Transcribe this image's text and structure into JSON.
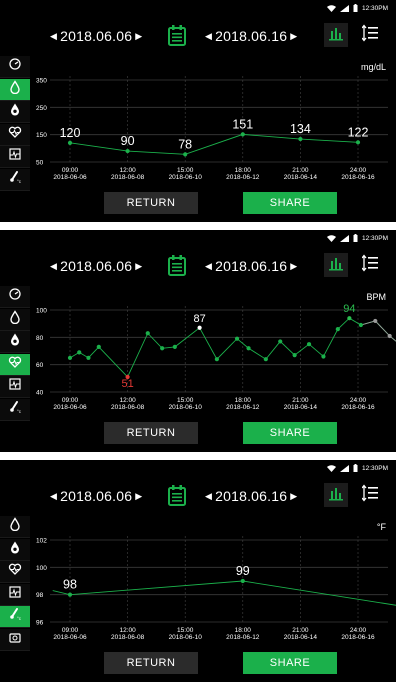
{
  "colors": {
    "accent": "#1bb04b",
    "background": "#000000",
    "grid": "#3a3a3a",
    "low": "#e53935",
    "high_label": "#2bbd4f"
  },
  "status": {
    "time": "12:30PM",
    "icons": [
      "wifi-icon",
      "signal-icon",
      "battery-icon"
    ]
  },
  "panels": [
    {
      "start_date": "2018.06.06",
      "end_date": "2018.06.16",
      "unit": "mg/dL",
      "active_metric": "glucose",
      "sidebar": [
        "blood-pressure-icon",
        "glucose-drop-icon",
        "oxygen-drop-icon",
        "heart-rate-icon",
        "ecg-icon",
        "temperature-icon"
      ],
      "return_label": "RETURN",
      "share_label": "SHARE",
      "chart_data": {
        "type": "line",
        "ylim": [
          50,
          350
        ],
        "yticks": [
          "350",
          "250",
          "150",
          "50"
        ],
        "ytick_values": [
          350,
          250,
          150,
          50
        ],
        "xtick_times": [
          "09:00",
          "12:00",
          "15:00",
          "18:00",
          "21:00",
          "24:00"
        ],
        "xtick_dates": [
          "2018-06-06",
          "2018-06-08",
          "2018-06-10",
          "2018-06-12",
          "2018-06-14",
          "2018-06-16"
        ],
        "points": [
          {
            "x": 0,
            "y": 120,
            "label": "120"
          },
          {
            "x": 1,
            "y": 90,
            "label": "90"
          },
          {
            "x": 2,
            "y": 78,
            "label": "78"
          },
          {
            "x": 3,
            "y": 151,
            "label": "151"
          },
          {
            "x": 4,
            "y": 134,
            "label": "134"
          },
          {
            "x": 5,
            "y": 122,
            "label": "122"
          }
        ]
      }
    },
    {
      "start_date": "2018.06.06",
      "end_date": "2018.06.16",
      "unit": "BPM",
      "active_metric": "heart-rate",
      "sidebar": [
        "blood-pressure-icon",
        "glucose-drop-icon",
        "oxygen-drop-icon",
        "heart-rate-icon",
        "ecg-icon",
        "temperature-icon"
      ],
      "return_label": "RETURN",
      "share_label": "SHARE",
      "chart_data": {
        "type": "line",
        "ylim": [
          40,
          100
        ],
        "yticks": [
          "100",
          "80",
          "60",
          "40"
        ],
        "ytick_values": [
          100,
          80,
          60,
          40
        ],
        "xtick_times": [
          "09:00",
          "12:00",
          "15:00",
          "18:00",
          "21:00",
          "24:00"
        ],
        "xtick_dates": [
          "2018-06-06",
          "2018-06-08",
          "2018-06-10",
          "2018-06-12",
          "2018-06-14",
          "2018-06-16"
        ],
        "points": [
          {
            "x": 0.0,
            "y": 65
          },
          {
            "x": 0.16,
            "y": 69
          },
          {
            "x": 0.32,
            "y": 65
          },
          {
            "x": 0.5,
            "y": 73
          },
          {
            "x": 1.0,
            "y": 51,
            "label": "51",
            "color": "#e53935"
          },
          {
            "x": 1.35,
            "y": 83
          },
          {
            "x": 1.6,
            "y": 72
          },
          {
            "x": 1.82,
            "y": 73
          },
          {
            "x": 2.25,
            "y": 87,
            "label": "87",
            "color": "#ffffff"
          },
          {
            "x": 2.55,
            "y": 64
          },
          {
            "x": 2.9,
            "y": 79
          },
          {
            "x": 3.1,
            "y": 72
          },
          {
            "x": 3.4,
            "y": 64
          },
          {
            "x": 3.65,
            "y": 77
          },
          {
            "x": 3.9,
            "y": 67
          },
          {
            "x": 4.15,
            "y": 75
          },
          {
            "x": 4.4,
            "y": 66
          },
          {
            "x": 4.65,
            "y": 86
          },
          {
            "x": 4.85,
            "y": 94,
            "label": "94",
            "color": "#2bbd4f"
          },
          {
            "x": 5.05,
            "y": 89
          },
          {
            "x": 5.3,
            "y": 92
          },
          {
            "x": 5.55,
            "y": 81
          },
          {
            "x": 5.75,
            "y": 74
          },
          {
            "x": 5.95,
            "y": 86
          }
        ]
      }
    },
    {
      "start_date": "2018.06.06",
      "end_date": "2018.06.16",
      "unit": "°F",
      "active_metric": "temperature",
      "sidebar": [
        "glucose-drop-icon",
        "oxygen-drop-icon",
        "heart-rate-icon",
        "ecg-icon",
        "temperature-icon",
        "scale-icon"
      ],
      "return_label": "RETURN",
      "share_label": "SHARE",
      "chart_data": {
        "type": "line",
        "ylim": [
          96,
          102
        ],
        "yticks": [
          "102",
          "100",
          "98",
          "96"
        ],
        "ytick_values": [
          102,
          100,
          98,
          96
        ],
        "xtick_times": [
          "09:00",
          "12:00",
          "15:00",
          "18:00",
          "21:00",
          "24:00"
        ],
        "xtick_dates": [
          "2018-06-06",
          "2018-06-08",
          "2018-06-10",
          "2018-06-12",
          "2018-06-14",
          "2018-06-16"
        ],
        "points": [
          {
            "x": -0.3,
            "y": 98.3
          },
          {
            "x": 0,
            "y": 98,
            "label": "98"
          },
          {
            "x": 3,
            "y": 99,
            "label": "99"
          },
          {
            "x": 6,
            "y": 97,
            "label": "97"
          }
        ]
      }
    }
  ]
}
